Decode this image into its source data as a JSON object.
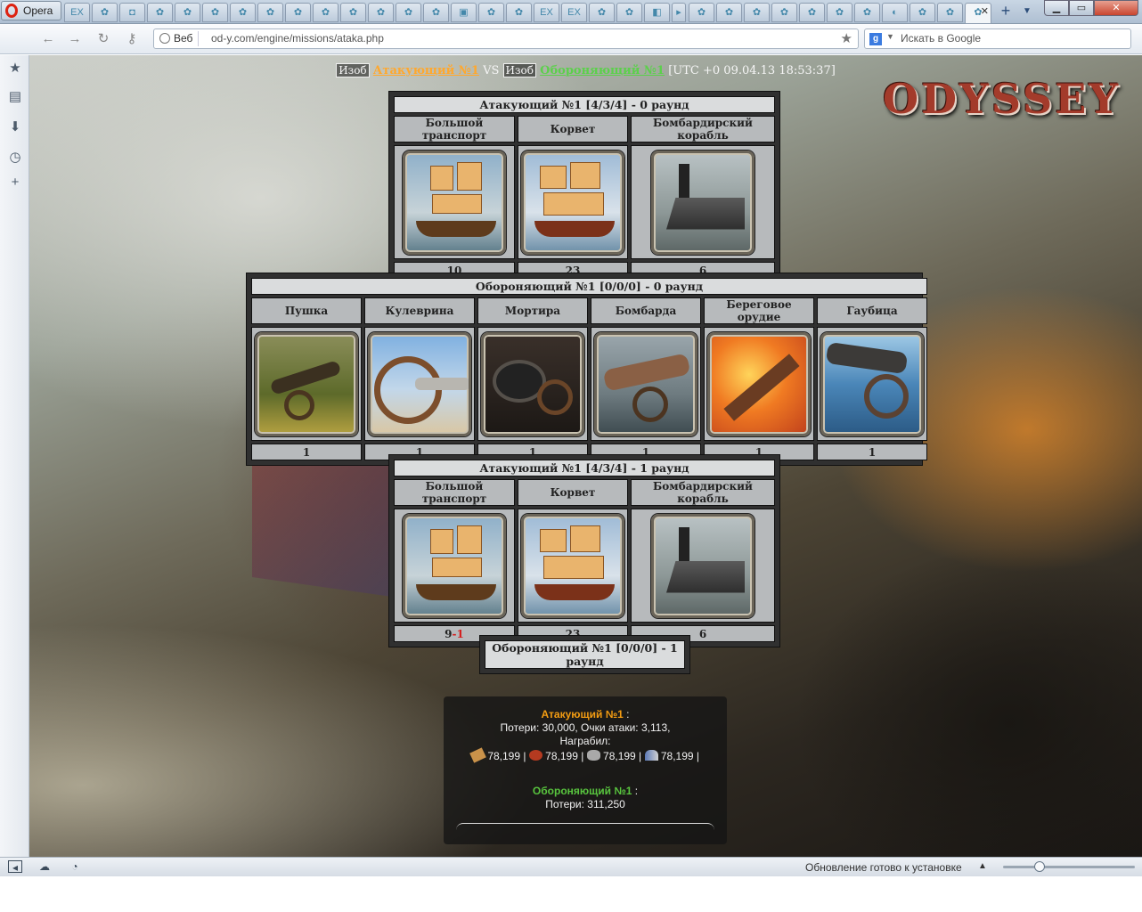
{
  "browser": {
    "menu_label": "Opera",
    "url_badge": "Веб",
    "url": "od-y.com/engine/missions/ataka.php",
    "search_placeholder": "Искать в Google",
    "status_text": "Обновление готово к установке",
    "tabs": [
      "EX",
      "EX",
      "EX"
    ]
  },
  "page": {
    "logo": "ODYSSEY",
    "izob": "Изоб",
    "attacker": "Атакующий №1",
    "vs": "VS",
    "defender": "Обороняющий №1",
    "timestamp": "[UTC +0 09.04.13 18:53:37]"
  },
  "rounds": [
    {
      "title": "Атакующий №1 [4/3/4] - 0 раунд",
      "units": [
        {
          "name": "Большой транспорт",
          "count": "10",
          "icon": "ship-transport-icon"
        },
        {
          "name": "Корвет",
          "count": "23",
          "icon": "ship-corvette-icon"
        },
        {
          "name": "Бомбардирский корабль",
          "count": "6",
          "icon": "ship-bombard-icon"
        }
      ]
    },
    {
      "title": "Обороняющий №1 [0/0/0] - 0 раунд",
      "units": [
        {
          "name": "Пушка",
          "count": "1",
          "icon": "cannon-icon"
        },
        {
          "name": "Кулеврина",
          "count": "1",
          "icon": "culverin-icon"
        },
        {
          "name": "Мортира",
          "count": "1",
          "icon": "mortar-icon"
        },
        {
          "name": "Бомбарда",
          "count": "1",
          "icon": "bombard-icon"
        },
        {
          "name": "Береговое орудие",
          "count": "1",
          "icon": "coastal-gun-icon"
        },
        {
          "name": "Гаубица",
          "count": "1",
          "icon": "howitzer-icon"
        }
      ]
    },
    {
      "title": "Атакующий №1 [4/3/4] - 1 раунд",
      "units": [
        {
          "name": "Большой транспорт",
          "count": "9",
          "loss": "-1",
          "icon": "ship-transport-icon"
        },
        {
          "name": "Корвет",
          "count": "23",
          "icon": "ship-corvette-icon"
        },
        {
          "name": "Бомбардирский корабль",
          "count": "6",
          "icon": "ship-bombard-icon"
        }
      ]
    },
    {
      "title": "Обороняющий №1 [0/0/0] - 1 раунд",
      "units": []
    }
  ],
  "summary": {
    "attacker": "Атакующий №1",
    "colon": ":",
    "attacker_losses": "Потери: 30,000, Очки атаки: 3,113,",
    "plundered": "Награбил:",
    "resources": [
      {
        "icon": "wood-icon",
        "value": "78,199 |"
      },
      {
        "icon": "food-icon",
        "value": "78,199 |"
      },
      {
        "icon": "stone-icon",
        "value": "78,199 |"
      },
      {
        "icon": "people-icon",
        "value": "78,199 |"
      }
    ],
    "defender": "Обороняющий №1",
    "defender_losses": "Потери: 311,250"
  }
}
